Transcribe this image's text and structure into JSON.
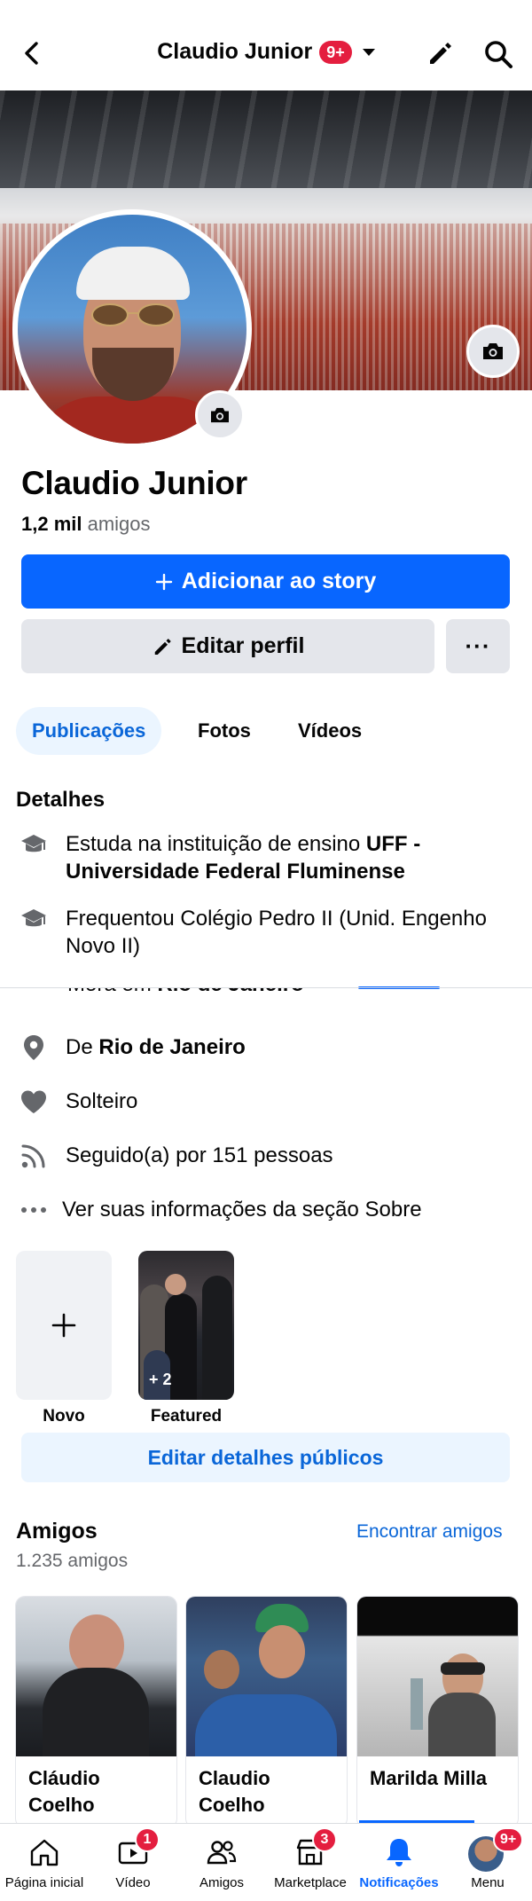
{
  "header": {
    "title": "Claudio Junior",
    "notif_badge": "9+"
  },
  "profile": {
    "name": "Claudio Junior",
    "friends_count": "1,2 mil",
    "friends_suffix": "amigos",
    "add_story_label": "Adicionar ao story",
    "edit_profile_label": "Editar perfil",
    "more_label": "···"
  },
  "tabs": [
    {
      "label": "Publicações",
      "active": true
    },
    {
      "label": "Fotos"
    },
    {
      "label": "Vídeos"
    }
  ],
  "details": {
    "heading": "Detalhes",
    "study_prefix": "Estuda na instituição de ensino ",
    "study_bold": "UFF - Universidade Federal Fluminense",
    "attended": "Frequentou Colégio Pedro II (Unid. Engenho Novo II)",
    "lives_prefix": "Mora em ",
    "lives_bold": "Rio de Janeiro",
    "from_prefix": "De ",
    "from_bold": "Rio de Janeiro",
    "relationship": "Solteiro",
    "followers": "Seguido(a) por 151 pessoas",
    "about_link": "Ver suas informações da seção Sobre"
  },
  "highlights": {
    "new_label": "Novo",
    "featured_label": "Featured",
    "featured_count": "+ 2"
  },
  "edit_public_label": "Editar detalhes públicos",
  "friends": {
    "title": "Amigos",
    "count": "1.235 amigos",
    "find_label": "Encontrar amigos",
    "cards": [
      {
        "name": "Cláudio Coelho"
      },
      {
        "name": "Claudio Coelho"
      },
      {
        "name": "Marilda Milla"
      }
    ]
  },
  "bottom_nav": [
    {
      "label": "Página inicial",
      "icon": "home-icon"
    },
    {
      "label": "Vídeo",
      "icon": "video-icon",
      "badge": "1"
    },
    {
      "label": "Amigos",
      "icon": "friends-icon"
    },
    {
      "label": "Marketplace",
      "icon": "marketplace-icon",
      "badge": "3"
    },
    {
      "label": "Notificações",
      "icon": "bell-icon",
      "active": true
    },
    {
      "label": "Menu",
      "icon": "menu-avatar-icon",
      "badge": "9+"
    }
  ],
  "colors": {
    "primary": "#0866ff",
    "badge": "#e41e3f",
    "secondary_button": "#e4e6eb",
    "link": "#0a66d8"
  }
}
